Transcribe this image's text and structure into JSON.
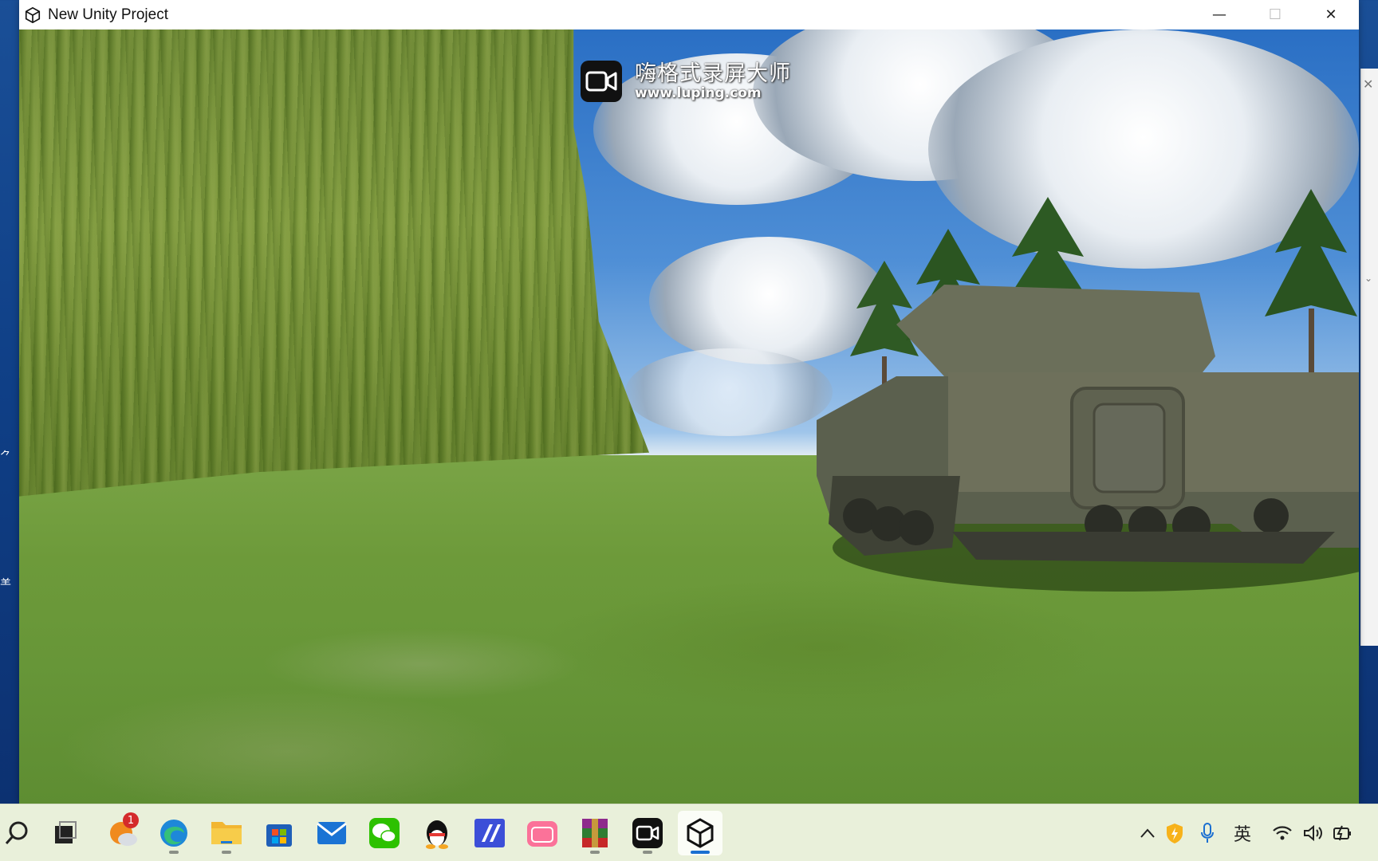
{
  "window": {
    "title": "New Unity Project",
    "controls": {
      "minimize": "—",
      "maximize": "☐",
      "close": "✕"
    }
  },
  "watermark": {
    "title": "嗨格式录屏大师",
    "url": "www.luping.com"
  },
  "desktop": {
    "left_glyphs": [
      "\u0000",
      "\u0000"
    ]
  },
  "taskbar": {
    "items": [
      {
        "icon": "search-icon"
      },
      {
        "icon": "task-view-icon"
      },
      {
        "icon": "weather-widget-icon",
        "badge": "1"
      },
      {
        "icon": "edge-browser-icon"
      },
      {
        "icon": "file-explorer-icon"
      },
      {
        "icon": "microsoft-store-icon"
      },
      {
        "icon": "mail-icon"
      },
      {
        "icon": "wechat-icon"
      },
      {
        "icon": "qq-icon"
      },
      {
        "icon": "visual-studio-icon"
      },
      {
        "icon": "bilibili-icon"
      },
      {
        "icon": "winrar-icon"
      },
      {
        "icon": "screen-recorder-icon"
      },
      {
        "icon": "unity-icon",
        "active": true
      }
    ],
    "tray": {
      "chevron": "^",
      "ime": "英"
    }
  },
  "colors": {
    "taskbar_bg": "#e9f0da",
    "accent": "#1a6fd1"
  }
}
